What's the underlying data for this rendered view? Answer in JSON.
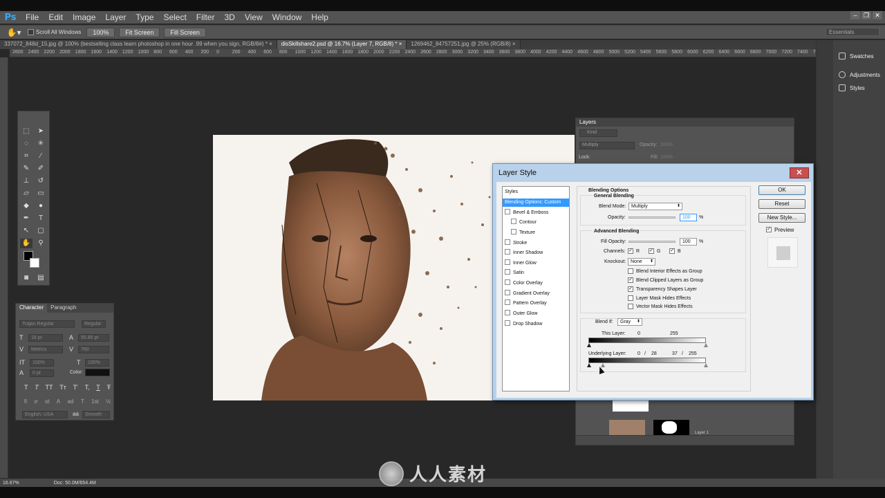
{
  "app": {
    "logo": "Ps",
    "menu": [
      "File",
      "Edit",
      "Image",
      "Layer",
      "Type",
      "Select",
      "Filter",
      "3D",
      "View",
      "Window",
      "Help"
    ],
    "window_controls": [
      "–",
      "❐",
      "✕"
    ]
  },
  "options_bar": {
    "scroll_all_label": "Scroll All Windows",
    "zoom_label": "100%",
    "fit_screen_label": "Fit Screen",
    "fill_screen_label": "Fill Screen",
    "workspace": "Essentials"
  },
  "doc_tabs": [
    {
      "label": "337072_848d_15.jpg @ 100% (bestselling class learn photoshop in one hour .99 when you sign, RGB/8#) *",
      "close": "×"
    },
    {
      "label": "disSkillshare2.psd @ 16.7% (Layer 7, RGB/8) *",
      "close": "×"
    },
    {
      "label": "1269462_84757251.jpg @ 25% (RGB/8)",
      "close": "×"
    }
  ],
  "ruler_ticks": [
    "2600",
    "2400",
    "2200",
    "2000",
    "1800",
    "1600",
    "1400",
    "1200",
    "1000",
    "800",
    "600",
    "400",
    "200",
    "0",
    "200",
    "400",
    "600",
    "800",
    "1000",
    "1200",
    "1400",
    "1600",
    "1800",
    "2000",
    "2200",
    "2400",
    "2600",
    "2800",
    "3000",
    "3200",
    "3400",
    "3600",
    "3800",
    "4000",
    "4200",
    "4400",
    "4600",
    "4800",
    "5000",
    "5200",
    "5400",
    "5600",
    "5800",
    "6000",
    "6200",
    "6400",
    "6600",
    "6800",
    "7000",
    "7200",
    "7400",
    "7600"
  ],
  "character_panel": {
    "tab_character": "Character",
    "tab_paragraph": "Paragraph",
    "font_family": "Trajan Regular",
    "font_style": "Regular",
    "font_size": "18 pt",
    "leading": "55.85 pt",
    "kerning": "Metrics",
    "tracking": "760",
    "vscale": "100%",
    "hscale": "100%",
    "baseline": "0 pt",
    "color_label": "Color:",
    "language": "English: USA",
    "aa_label": "aa",
    "antialias": "Smooth",
    "style_buttons": [
      "T",
      "T",
      "TT",
      "Tт",
      "T'",
      "T,",
      "T",
      "Ŧ"
    ],
    "opentype_buttons": [
      "fi",
      "ơ",
      "st",
      "A",
      "ad",
      "T",
      "1st",
      "½"
    ]
  },
  "layers_panel": {
    "title": "Layers",
    "filter_kind": "Kind",
    "blend_mode": "Multiply",
    "opacity_label": "Opacity:",
    "opacity_value": "100%",
    "lock_label": "Lock:",
    "fill_label": "Fill:",
    "fill_value": "100%",
    "layer_name": "Layer 1"
  },
  "right_dock": {
    "items": [
      "Swatches",
      "Adjustments",
      "Styles"
    ]
  },
  "status": {
    "zoom": "16.67%",
    "doc": "Doc: 50.0M/654.4M"
  },
  "dialog": {
    "title": "Layer Style",
    "close": "✕",
    "styles_header": "Styles",
    "style_items": [
      {
        "label": "Blending Options: Custom",
        "selected": true,
        "checkbox": false
      },
      {
        "label": "Bevel & Emboss",
        "checkbox": true
      },
      {
        "label": "Contour",
        "checkbox": true,
        "indent": true
      },
      {
        "label": "Texture",
        "checkbox": true,
        "indent": true
      },
      {
        "label": "Stroke",
        "checkbox": true
      },
      {
        "label": "Inner Shadow",
        "checkbox": true
      },
      {
        "label": "Inner Glow",
        "checkbox": true
      },
      {
        "label": "Satin",
        "checkbox": true
      },
      {
        "label": "Color Overlay",
        "checkbox": true
      },
      {
        "label": "Gradient Overlay",
        "checkbox": true
      },
      {
        "label": "Pattern Overlay",
        "checkbox": true
      },
      {
        "label": "Outer Glow",
        "checkbox": true
      },
      {
        "label": "Drop Shadow",
        "checkbox": true
      }
    ],
    "blending_options_title": "Blending Options",
    "general_blending": "General Blending",
    "blend_mode_label": "Blend Mode:",
    "blend_mode_value": "Multiply",
    "opacity_label": "Opacity:",
    "opacity_value": "100",
    "percent": "%",
    "advanced_blending": "Advanced Blending",
    "fill_opacity_label": "Fill Opacity:",
    "fill_opacity_value": "100",
    "channels_label": "Channels:",
    "channel_r": "R",
    "channel_g": "G",
    "channel_b": "B",
    "knockout_label": "Knockout:",
    "knockout_value": "None",
    "adv_options": [
      {
        "label": "Blend Interior Effects as Group",
        "checked": false
      },
      {
        "label": "Blend Clipped Layers as Group",
        "checked": true
      },
      {
        "label": "Transparency Shapes Layer",
        "checked": true
      },
      {
        "label": "Layer Mask Hides Effects",
        "checked": false
      },
      {
        "label": "Vector Mask Hides Effects",
        "checked": false
      }
    ],
    "blend_if_label": "Blend If:",
    "blend_if_value": "Gray",
    "this_layer_label": "This Layer:",
    "this_layer_low": "0",
    "this_layer_high": "255",
    "underlying_label": "Underlying Layer:",
    "underlying_low1": "0",
    "underlying_slash1": "/",
    "underlying_low2": "28",
    "underlying_high1": "37",
    "underlying_slash2": "/",
    "underlying_high2": "255",
    "ok": "OK",
    "reset": "Reset",
    "new_style": "New Style...",
    "preview": "Preview",
    "check": "✓"
  },
  "watermark": {
    "text": "人人素材"
  }
}
